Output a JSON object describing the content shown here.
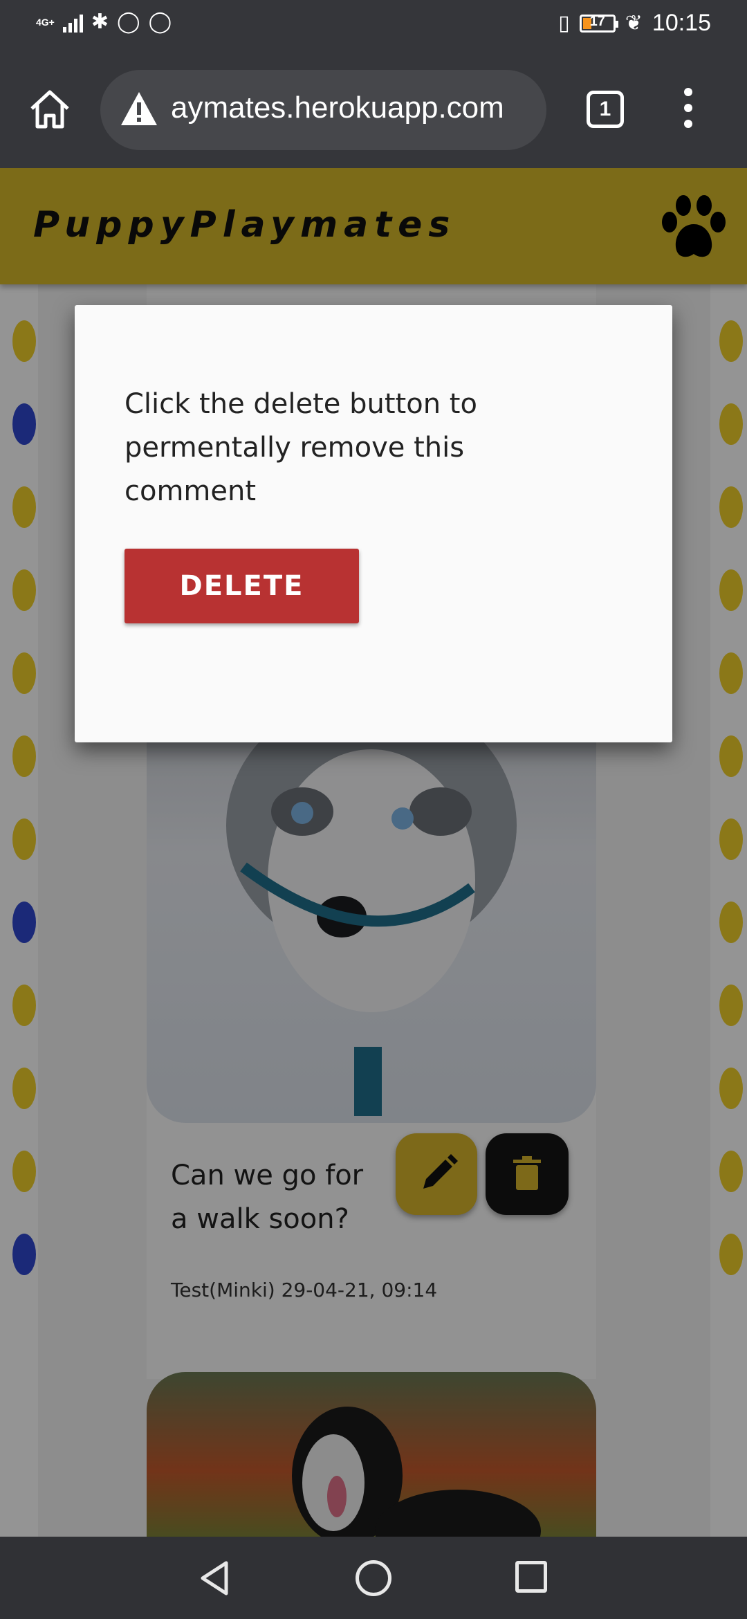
{
  "status_bar": {
    "network": "4G+",
    "battery_level": "17",
    "time": "10:15"
  },
  "browser": {
    "url": "puppyplaymates.herokuapp.com",
    "url_visible": "aymates.herokuapp.com",
    "tab_count": "1"
  },
  "site": {
    "brand": "PuppyPlaymates",
    "colors": {
      "header": "#d6b82a",
      "delete": "#b83232",
      "edit": "#d8b52b"
    }
  },
  "modal": {
    "message": "Click the delete button to permentally remove this comment",
    "delete_label": "DELETE"
  },
  "post": {
    "comment": "Can we go for a walk soon?",
    "meta": "Test(Minki) 29-04-21, 09:14"
  },
  "icons": {
    "edit": "pencil-icon",
    "delete": "trash-icon",
    "brand": "paw-icon"
  }
}
